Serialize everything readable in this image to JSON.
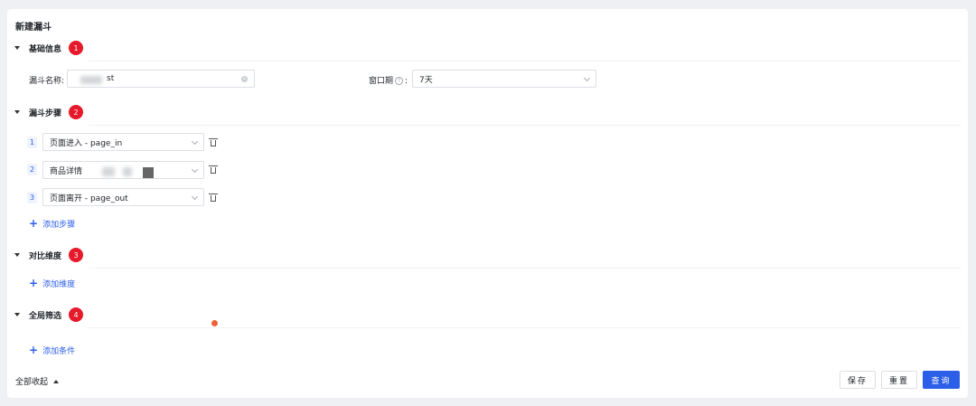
{
  "page_title": "新建漏斗",
  "sections": {
    "basic": {
      "title": "基础信息",
      "badge": "1"
    },
    "steps": {
      "title": "漏斗步骤",
      "badge": "2"
    },
    "dimension": {
      "title": "对比维度",
      "badge": "3"
    },
    "filter": {
      "title": "全局筛选",
      "badge": "4"
    }
  },
  "basic_info": {
    "name_label": "漏斗名称:",
    "name_value": "st",
    "window_label": "窗口期",
    "window_help": "?",
    "window_colon": ":",
    "window_value": "7天"
  },
  "funnel_steps": [
    {
      "num": "1",
      "value": "页面进入 - page_in"
    },
    {
      "num": "2",
      "value": "商品详情"
    },
    {
      "num": "3",
      "value": "页面离开 - page_out"
    }
  ],
  "links": {
    "add_step": "添加步骤",
    "add_dimension": "添加维度",
    "add_condition": "添加条件"
  },
  "footer": {
    "collapse_all": "全部收起",
    "save": "保存",
    "reset": "重置",
    "query": "查询"
  }
}
